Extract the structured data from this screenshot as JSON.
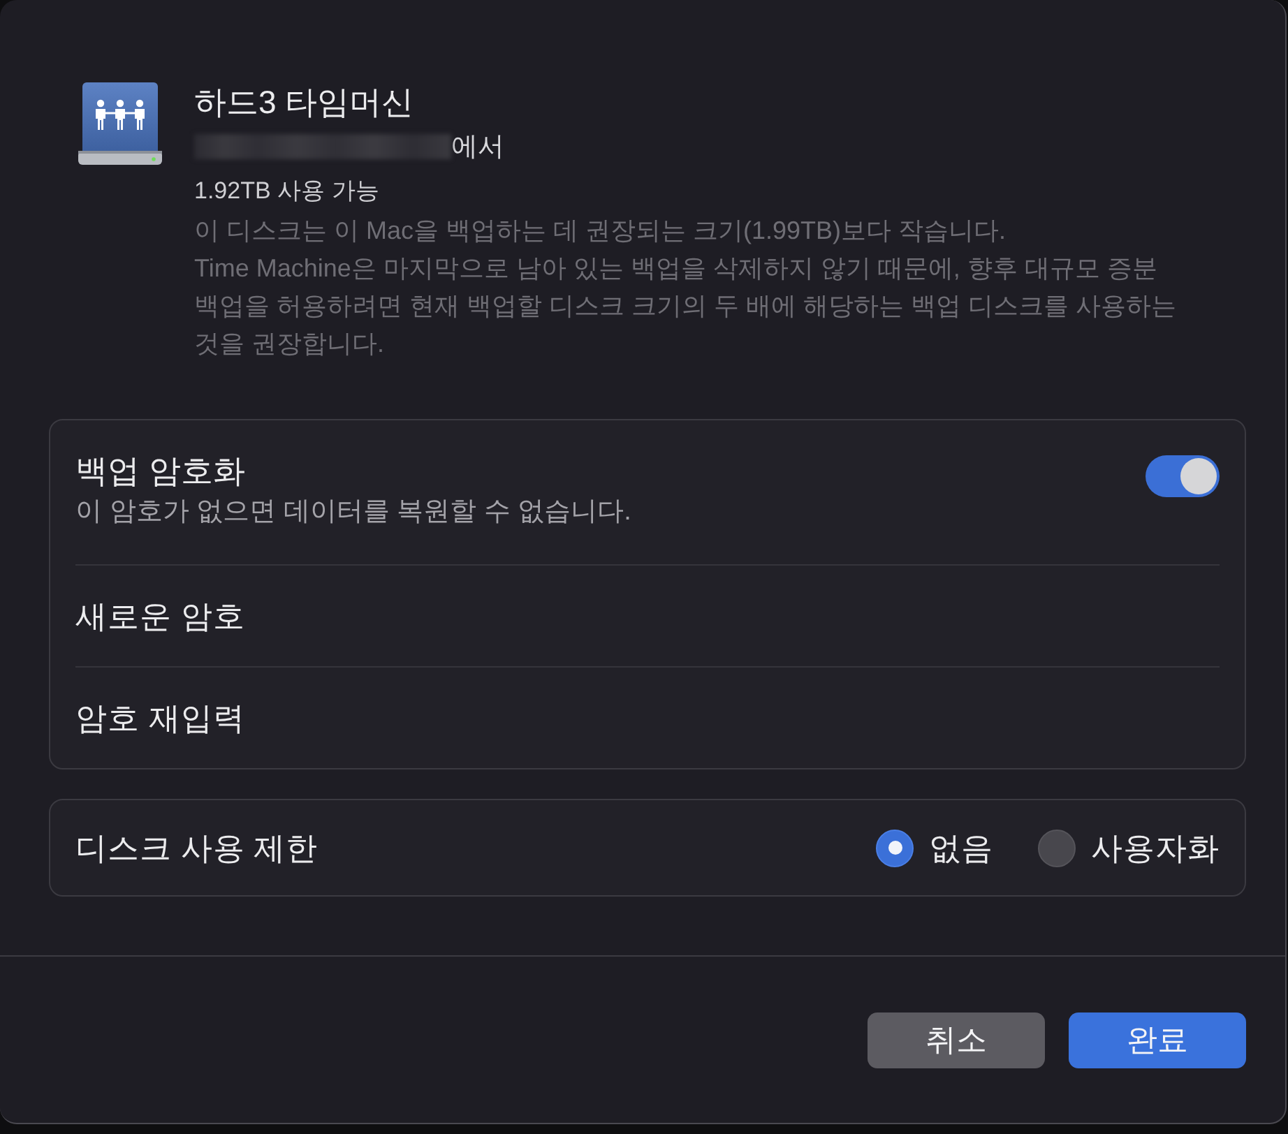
{
  "disk": {
    "name": "하드3 타임머신",
    "source_suffix": "에서",
    "available": "1.92TB 사용 가능",
    "warning": [
      "이 디스크는 이 Mac을 백업하는 데 권장되는 크기(1.99TB)보다 작습니다.",
      "Time Machine은 마지막으로 남아 있는 백업을 삭제하지 않기 때문에, 향후 대규모 증분 백업을 허용하려면 현재 백업할 디스크 크기의 두 배에 해당하는 백업 디스크를 사용하는 것을 권장합니다."
    ]
  },
  "encryption": {
    "title": "백업 암호화",
    "description": "이 암호가 없으면 데이터를 복원할 수 없습니다.",
    "on": true,
    "fields": [
      {
        "label": "새로운 암호"
      },
      {
        "label": "암호 재입력"
      }
    ]
  },
  "disk_limit": {
    "label": "디스크 사용 제한",
    "options": [
      {
        "label": "없음",
        "selected": true
      },
      {
        "label": "사용자화",
        "selected": false
      }
    ]
  },
  "buttons": [
    {
      "label": "취소",
      "kind": "secondary"
    },
    {
      "label": "완료",
      "kind": "primary"
    }
  ]
}
